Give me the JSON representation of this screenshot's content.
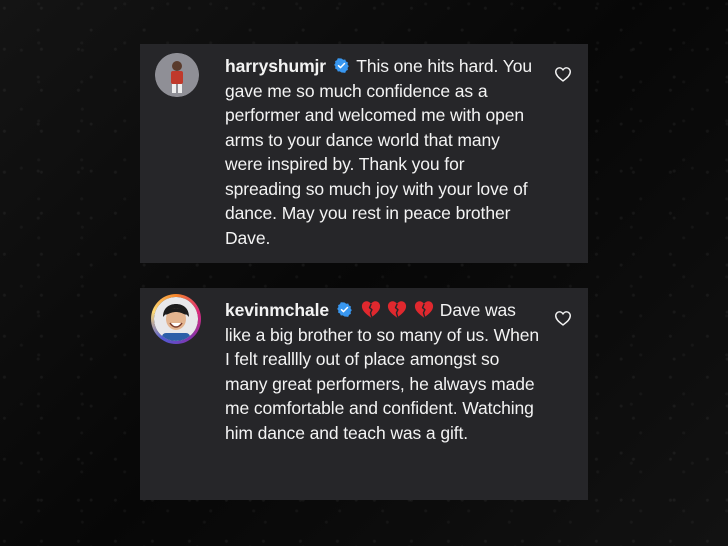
{
  "comments": [
    {
      "username": "harryshumjr",
      "text": "This one hits hard. You gave me so much confidence as a performer and welcomed me with open arms to your dance world that many were inspired by. Thank you for spreading so much joy with your love of dance. May you rest in peace brother Dave.",
      "verified": true,
      "emojis": []
    },
    {
      "username": "kevinmchale",
      "text": "Dave was like a big brother to so many of us. When I felt realllly out of place amongst so many great performers, he always made me comfortable and confident. Watching him dance and teach was a gift.",
      "verified": true,
      "emojis": [
        "broken-heart",
        "broken-heart",
        "broken-heart"
      ]
    }
  ],
  "colors": {
    "card_bg": "#262629",
    "text": "#f3f3f3",
    "verified_blue": "#3897f0",
    "broken_heart_red": "#e0282e"
  }
}
